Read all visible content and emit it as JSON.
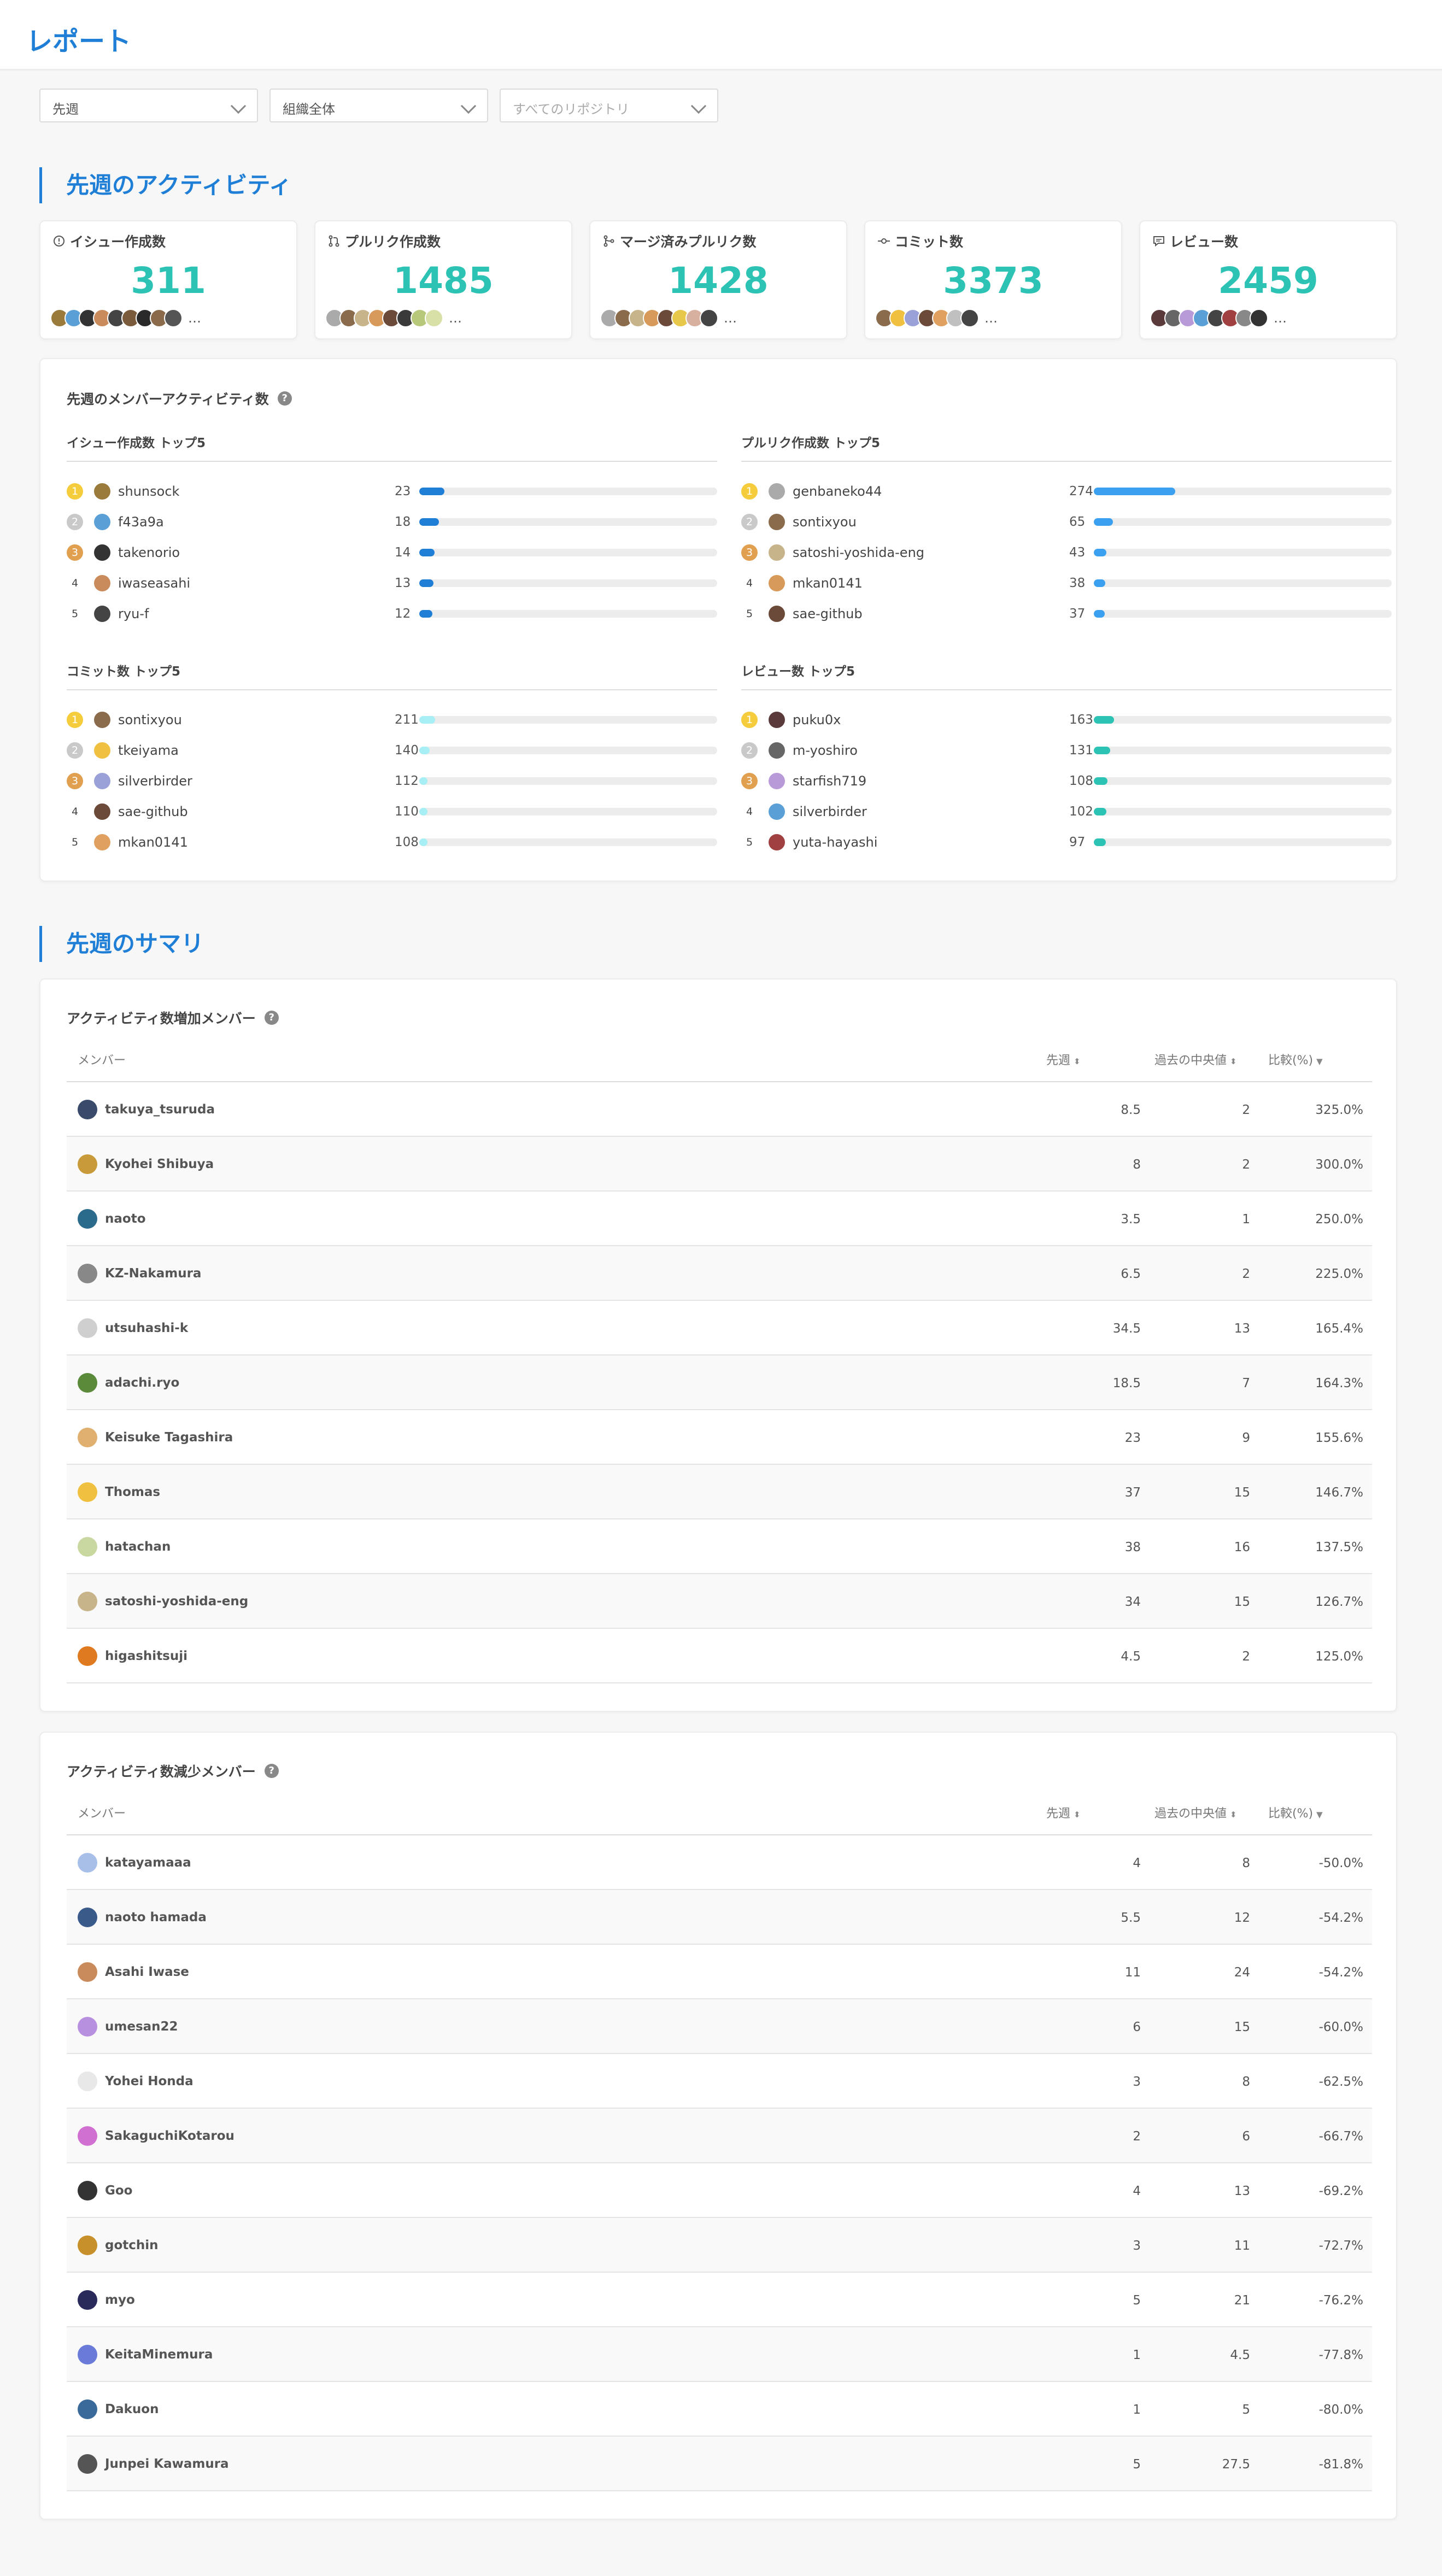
{
  "page": {
    "title": "レポート"
  },
  "filters": {
    "period": "先週",
    "org": "組織全体",
    "repo_placeholder": "すべてのリポジトリ"
  },
  "activity": {
    "title": "先週のアクティビティ",
    "stats": [
      {
        "label": "イシュー作成数",
        "icon": "issue-icon",
        "value": "311",
        "avatars": [
          "#9a7b3c",
          "#5aa0d6",
          "#333333",
          "#c98a5c",
          "#444444",
          "#7a5c3c",
          "#2a2a2a",
          "#8a6a4a",
          "#555555"
        ]
      },
      {
        "label": "プルリク作成数",
        "icon": "pull-request-icon",
        "value": "1485",
        "avatars": [
          "#aaaaaa",
          "#8a6b4c",
          "#c8b48a",
          "#d89a5a",
          "#6b4a3a",
          "#3a3a3a",
          "#b8c87a",
          "#d8e0a8"
        ]
      },
      {
        "label": "マージ済みプルリク数",
        "icon": "merge-icon",
        "value": "1428",
        "avatars": [
          "#aaaaaa",
          "#8a6b4c",
          "#c8b48a",
          "#d89a5a",
          "#6b4a3a",
          "#e8c84a",
          "#d8b0a0",
          "#444444"
        ]
      },
      {
        "label": "コミット数",
        "icon": "commit-icon",
        "value": "3373",
        "avatars": [
          "#8a6b4c",
          "#f0c040",
          "#9aa0d8",
          "#6b4a3a",
          "#e0a060",
          "#c0c0c0",
          "#444444"
        ]
      },
      {
        "label": "レビュー数",
        "icon": "review-icon",
        "value": "2459",
        "avatars": [
          "#5a3a3a",
          "#666666",
          "#b89ad8",
          "#5aa0d6",
          "#444444",
          "#a04040",
          "#888888",
          "#333333"
        ]
      }
    ],
    "members": {
      "title": "先週のメンバーアクティビティ数",
      "help": "?",
      "groups": [
        {
          "title": "イシュー作成数 トップ5",
          "color": "#1f7ed6",
          "max": 274,
          "rows": [
            {
              "rank": "1",
              "name": "shunsock",
              "count": 23,
              "avatar": "#9a7b3c"
            },
            {
              "rank": "2",
              "name": "f43a9a",
              "count": 18,
              "avatar": "#5aa0d6"
            },
            {
              "rank": "3",
              "name": "takenorio",
              "count": 14,
              "avatar": "#333333"
            },
            {
              "rank": "4",
              "name": "iwaseasahi",
              "count": 13,
              "avatar": "#c98a5c"
            },
            {
              "rank": "5",
              "name": "ryu-f",
              "count": 12,
              "avatar": "#444444"
            }
          ]
        },
        {
          "title": "プルリク作成数 トップ5",
          "color": "#3aa0ef",
          "max": 1000,
          "rows": [
            {
              "rank": "1",
              "name": "genbaneko44",
              "count": 274,
              "avatar": "#aaaaaa"
            },
            {
              "rank": "2",
              "name": "sontixyou",
              "count": 65,
              "avatar": "#8a6b4c"
            },
            {
              "rank": "3",
              "name": "satoshi-yoshida-eng",
              "count": 43,
              "avatar": "#c8b48a"
            },
            {
              "rank": "4",
              "name": "mkan0141",
              "count": 38,
              "avatar": "#d89a5a"
            },
            {
              "rank": "5",
              "name": "sae-github",
              "count": 37,
              "avatar": "#6b4a3a"
            }
          ]
        },
        {
          "title": "コミット数 トップ5",
          "color": "#a8eef5",
          "max": 4000,
          "rows": [
            {
              "rank": "1",
              "name": "sontixyou",
              "count": 211,
              "avatar": "#8a6b4c"
            },
            {
              "rank": "2",
              "name": "tkeiyama",
              "count": 140,
              "avatar": "#f0c040"
            },
            {
              "rank": "3",
              "name": "silverbirder",
              "count": 112,
              "avatar": "#9aa0d8"
            },
            {
              "rank": "4",
              "name": "sae-github",
              "count": 110,
              "avatar": "#6b4a3a"
            },
            {
              "rank": "5",
              "name": "mkan0141",
              "count": 108,
              "avatar": "#e0a060"
            }
          ]
        },
        {
          "title": "レビュー数 トップ5",
          "color": "#2cc3b5",
          "max": 2400,
          "rows": [
            {
              "rank": "1",
              "name": "puku0x",
              "count": 163,
              "avatar": "#5a3a3a"
            },
            {
              "rank": "2",
              "name": "m-yoshiro",
              "count": 131,
              "avatar": "#666666"
            },
            {
              "rank": "3",
              "name": "starfish719",
              "count": 108,
              "avatar": "#b89ad8"
            },
            {
              "rank": "4",
              "name": "silverbirder",
              "count": 102,
              "avatar": "#5aa0d6"
            },
            {
              "rank": "5",
              "name": "yuta-hayashi",
              "count": 97,
              "avatar": "#a04040"
            }
          ]
        }
      ]
    }
  },
  "summary": {
    "title": "先週のサマリ",
    "columns": {
      "member": "メンバー",
      "last": "先週",
      "median": "過去の中央値",
      "compare": "比較(%)"
    },
    "increase": {
      "title": "アクティビティ数増加メンバー",
      "rows": [
        {
          "name": "takuya_tsuruda",
          "last": "8.5",
          "median": "2",
          "compare": "325.0%",
          "avatar": "#3a4a6a"
        },
        {
          "name": "Kyohei Shibuya",
          "last": "8",
          "median": "2",
          "compare": "300.0%",
          "avatar": "#c89a3a"
        },
        {
          "name": "naoto",
          "last": "3.5",
          "median": "1",
          "compare": "250.0%",
          "avatar": "#2a6a8a"
        },
        {
          "name": "KZ-Nakamura",
          "last": "6.5",
          "median": "2",
          "compare": "225.0%",
          "avatar": "#888888"
        },
        {
          "name": "utsuhashi-k",
          "last": "34.5",
          "median": "13",
          "compare": "165.4%",
          "avatar": "#cfcfcf"
        },
        {
          "name": "adachi.ryo",
          "last": "18.5",
          "median": "7",
          "compare": "164.3%",
          "avatar": "#5a8a3a"
        },
        {
          "name": "Keisuke Tagashira",
          "last": "23",
          "median": "9",
          "compare": "155.6%",
          "avatar": "#e0b070"
        },
        {
          "name": "Thomas",
          "last": "37",
          "median": "15",
          "compare": "146.7%",
          "avatar": "#f0c040"
        },
        {
          "name": "hatachan",
          "last": "38",
          "median": "16",
          "compare": "137.5%",
          "avatar": "#c8d8a0"
        },
        {
          "name": "satoshi-yoshida-eng",
          "last": "34",
          "median": "15",
          "compare": "126.7%",
          "avatar": "#c8b48a"
        },
        {
          "name": "higashitsuji",
          "last": "4.5",
          "median": "2",
          "compare": "125.0%",
          "avatar": "#e07a20"
        }
      ]
    },
    "decrease": {
      "title": "アクティビティ数減少メンバー",
      "rows": [
        {
          "name": "katayamaaa",
          "last": "4",
          "median": "8",
          "compare": "-50.0%",
          "avatar": "#a8c0e8"
        },
        {
          "name": "naoto hamada",
          "last": "5.5",
          "median": "12",
          "compare": "-54.2%",
          "avatar": "#3a5a8a"
        },
        {
          "name": "Asahi Iwase",
          "last": "11",
          "median": "24",
          "compare": "-54.2%",
          "avatar": "#c98a5c"
        },
        {
          "name": "umesan22",
          "last": "6",
          "median": "15",
          "compare": "-60.0%",
          "avatar": "#b890e0"
        },
        {
          "name": "Yohei Honda",
          "last": "3",
          "median": "8",
          "compare": "-62.5%",
          "avatar": "#e8e8e8"
        },
        {
          "name": "SakaguchiKotarou",
          "last": "2",
          "median": "6",
          "compare": "-66.7%",
          "avatar": "#d070d0"
        },
        {
          "name": "Goo",
          "last": "4",
          "median": "13",
          "compare": "-69.2%",
          "avatar": "#333333"
        },
        {
          "name": "gotchin",
          "last": "3",
          "median": "11",
          "compare": "-72.7%",
          "avatar": "#c8902a"
        },
        {
          "name": "myo",
          "last": "5",
          "median": "21",
          "compare": "-76.2%",
          "avatar": "#2a2a5a"
        },
        {
          "name": "KeitaMinemura",
          "last": "1",
          "median": "4.5",
          "compare": "-77.8%",
          "avatar": "#6a7ad8"
        },
        {
          "name": "Dakuon",
          "last": "1",
          "median": "5",
          "compare": "-80.0%",
          "avatar": "#3a6a9a"
        },
        {
          "name": "Junpei Kawamura",
          "last": "5",
          "median": "27.5",
          "compare": "-81.8%",
          "avatar": "#555555"
        }
      ]
    }
  }
}
